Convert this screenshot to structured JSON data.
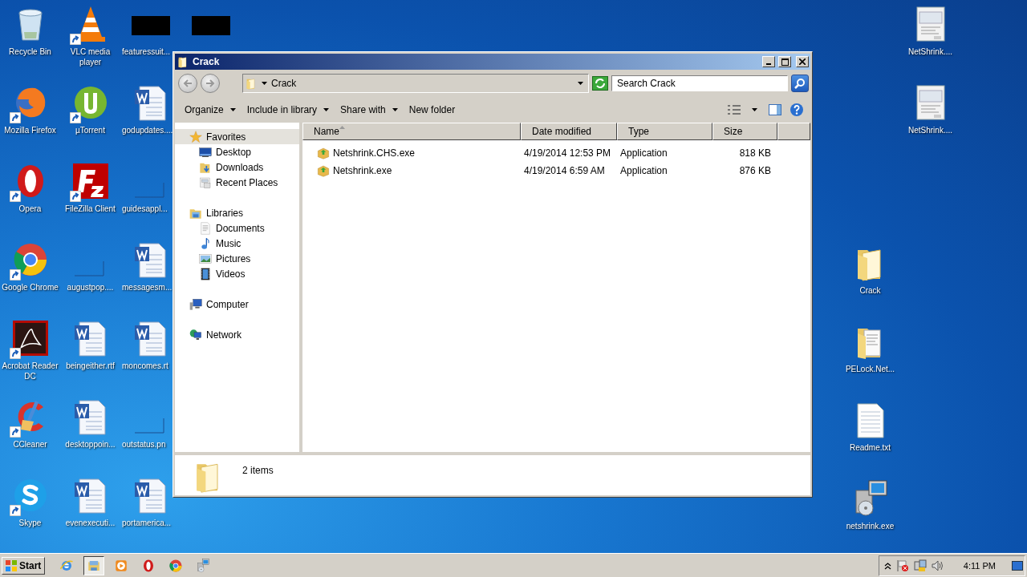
{
  "desktop": {
    "left_columns": [
      [
        {
          "label": "Recycle Bin",
          "kind": "recycle"
        },
        {
          "label": "Mozilla Firefox",
          "kind": "firefox",
          "shortcut": true
        },
        {
          "label": "Opera",
          "kind": "opera",
          "shortcut": true
        },
        {
          "label": "Google Chrome",
          "kind": "chrome",
          "shortcut": true
        },
        {
          "label": "Acrobat Reader DC",
          "kind": "acrobat",
          "shortcut": true
        },
        {
          "label": "CCleaner",
          "kind": "ccleaner",
          "shortcut": true
        },
        {
          "label": "Skype",
          "kind": "skype",
          "shortcut": true
        }
      ],
      [
        {
          "label": "VLC media player",
          "kind": "vlc",
          "shortcut": true
        },
        {
          "label": "µTorrent",
          "kind": "utorrent",
          "shortcut": true
        },
        {
          "label": "FileZilla Client",
          "kind": "filezilla",
          "shortcut": true
        },
        {
          "label": "augustpop....",
          "kind": "blank"
        },
        {
          "label": "beingeither.rtf",
          "kind": "word"
        },
        {
          "label": "desktoppoin...",
          "kind": "word"
        },
        {
          "label": "evenexecuti...",
          "kind": "word"
        }
      ],
      [
        {
          "label": "featuressuit...",
          "kind": "redacted"
        },
        {
          "label": "godupdates....",
          "kind": "word"
        },
        {
          "label": "guidesappl...",
          "kind": "blank"
        },
        {
          "label": "messagesm...",
          "kind": "word"
        },
        {
          "label": "moncomes.rt",
          "kind": "word"
        },
        {
          "label": "outstatus.pn",
          "kind": "blank"
        },
        {
          "label": "portamerica...",
          "kind": "word"
        }
      ],
      [
        {
          "kind": "redacted"
        }
      ]
    ],
    "right_columns": [
      [
        {
          "label": "Crack",
          "kind": "folder"
        },
        {
          "label": "PELock.Net...",
          "kind": "folder-docs"
        },
        {
          "label": "Readme.txt",
          "kind": "text"
        },
        {
          "label": "netshrink.exe",
          "kind": "installer"
        }
      ],
      [
        {
          "label": "NetShrink....",
          "kind": "dialog"
        },
        {
          "label": "NetShrink....",
          "kind": "dialog"
        }
      ]
    ]
  },
  "window": {
    "title": "Crack",
    "address": {
      "path": "Crack"
    },
    "search": {
      "placeholder": "Search Crack"
    },
    "commands": [
      {
        "label": "Organize",
        "menu": true
      },
      {
        "label": "Include in library",
        "menu": true
      },
      {
        "label": "Share with",
        "menu": true
      },
      {
        "label": "New folder",
        "menu": false
      }
    ],
    "navigation": [
      {
        "label": "Favorites",
        "kind": "star",
        "selected": true,
        "children": [
          {
            "label": "Desktop",
            "kind": "desktop",
            "selected": false
          },
          {
            "label": "Downloads",
            "kind": "downloads",
            "selected": false
          },
          {
            "label": "Recent Places",
            "kind": "recent",
            "selected": false
          }
        ]
      },
      {
        "label": "Libraries",
        "kind": "libraries",
        "selected": false,
        "children": [
          {
            "label": "Documents",
            "kind": "documents",
            "selected": false
          },
          {
            "label": "Music",
            "kind": "music",
            "selected": false
          },
          {
            "label": "Pictures",
            "kind": "pictures",
            "selected": false
          },
          {
            "label": "Videos",
            "kind": "videos",
            "selected": false
          }
        ]
      },
      {
        "label": "Computer",
        "kind": "computer",
        "selected": false
      },
      {
        "label": "Network",
        "kind": "network",
        "selected": false
      }
    ],
    "columns": [
      {
        "label": "Name",
        "sorted": true
      },
      {
        "label": "Date modified",
        "sorted": false
      },
      {
        "label": "Type",
        "sorted": false
      },
      {
        "label": "Size",
        "sorted": false
      }
    ],
    "files": [
      {
        "name": "Netshrink.CHS.exe",
        "date": "4/19/2014 12:53 PM",
        "type": "Application",
        "size": "818 KB"
      },
      {
        "name": "Netshrink.exe",
        "date": "4/19/2014 6:59 AM",
        "type": "Application",
        "size": "876 KB"
      }
    ],
    "status": "2 items"
  },
  "taskbar": {
    "start": "Start",
    "apps": [
      {
        "kind": "ie",
        "selected": false
      },
      {
        "kind": "explorer",
        "selected": true
      },
      {
        "kind": "mediaplayer",
        "selected": false
      },
      {
        "kind": "opera",
        "selected": false
      },
      {
        "kind": "chrome",
        "selected": false
      },
      {
        "kind": "installer",
        "selected": false
      }
    ],
    "clock": "4:11 PM"
  }
}
